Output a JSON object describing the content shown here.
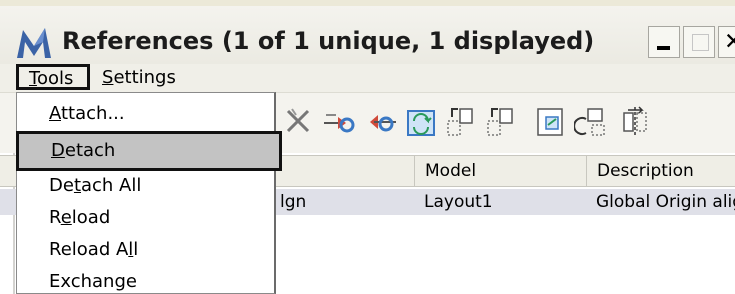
{
  "window": {
    "title": "References (1 of 1 unique, 1 displayed)"
  },
  "menubar": {
    "tools": {
      "pre": "",
      "ul": "T",
      "post": "ools"
    },
    "settings": {
      "pre": "",
      "ul": "S",
      "post": "ettings"
    }
  },
  "tools_menu": {
    "attach": {
      "pre": "",
      "ul": "A",
      "post": "ttach..."
    },
    "detach": {
      "pre": "",
      "ul": "D",
      "post": "etach"
    },
    "detach_all": {
      "pre": "De",
      "ul": "t",
      "post": "ach All"
    },
    "reload": {
      "pre": "R",
      "ul": "e",
      "post": "load"
    },
    "reload_all": {
      "pre": "Reload A",
      "ul": "l",
      "post": "l"
    },
    "exchange": {
      "pre": "Exchange",
      "ul": "",
      "post": ""
    }
  },
  "toolbar": {
    "icons": [
      "detach-x-icon",
      "eye-link-icon",
      "eye-link-left-icon",
      "rotate-reference-icon",
      "move-reference-icon",
      "copy-reference-icon",
      "scale-reference-icon",
      "rotate-small-icon",
      "mirror-reference-icon"
    ]
  },
  "table": {
    "headers": {
      "model": "Model",
      "description": "Description"
    },
    "rows": [
      {
        "file": "lgn",
        "model": "Layout1",
        "description": "Global Origin alig"
      }
    ]
  },
  "colors": {
    "highlight": "#c3c3c3",
    "selected_row": "#dfe0e8",
    "icon_blue": "#3a78c4",
    "icon_orange": "#e8a43a"
  }
}
